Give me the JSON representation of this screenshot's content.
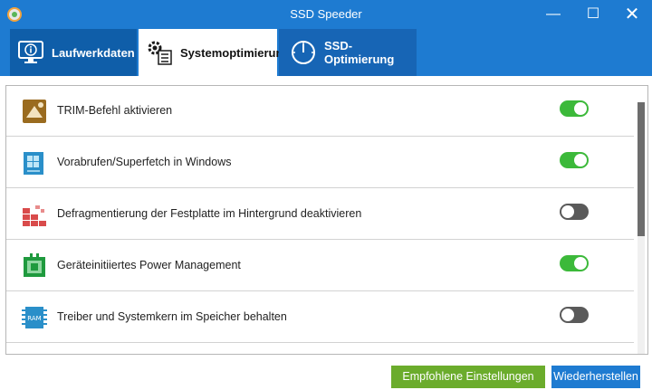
{
  "window": {
    "title": "SSD Speeder",
    "minimize_glyph": "—",
    "maximize_glyph": "☐",
    "close_glyph": "✕"
  },
  "tabs": [
    {
      "label": "Laufwerkdaten",
      "icon": "monitor-info-icon"
    },
    {
      "label": "Systemoptimierung",
      "icon": "gears-checklist-icon"
    },
    {
      "label": "SSD-Optimierung",
      "icon": "gauge-icon"
    }
  ],
  "settings": [
    {
      "label": "TRIM-Befehl aktivieren",
      "icon": "trim-drive-icon",
      "enabled": true
    },
    {
      "label": "Vorabrufen/Superfetch in Windows",
      "icon": "windows-document-icon",
      "enabled": true
    },
    {
      "label": "Defragmentierung der Festplatte im Hintergrund deaktivieren",
      "icon": "defrag-blocks-icon",
      "enabled": false
    },
    {
      "label": "Geräteinitiiertes Power Management",
      "icon": "power-chip-icon",
      "enabled": true
    },
    {
      "label": "Treiber und Systemkern im Speicher behalten",
      "icon": "ram-icon",
      "enabled": false
    }
  ],
  "buttons": {
    "recommended": "Empfohlene Einstellungen",
    "restore": "Wiederherstellen"
  },
  "colors": {
    "accent": "#1e7bd1",
    "toggle_on": "#3cb93a",
    "toggle_off": "#5a5a5a",
    "recommended_button": "#6bac2c"
  }
}
